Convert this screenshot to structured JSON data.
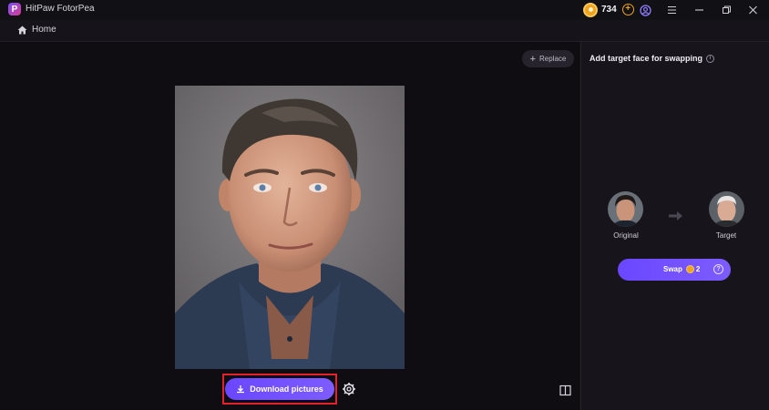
{
  "titlebar": {
    "app_logo_letter": "P",
    "app_title": "HitPaw FotorPea",
    "coin_count": "734",
    "coin_add": "+"
  },
  "nav": {
    "home_label": "Home"
  },
  "workspace": {
    "replace_label": "Replace",
    "download_label": "Download pictures"
  },
  "panel": {
    "title": "Add target face for swapping",
    "info_glyph": "i",
    "original_label": "Original",
    "target_label": "Target",
    "swap_label": "Swap",
    "swap_cost": "2",
    "help_glyph": "?"
  },
  "colors": {
    "accent": "#6a47ff",
    "coin": "#f0a31e",
    "highlight_border": "#e0232b",
    "background": "#141218"
  }
}
